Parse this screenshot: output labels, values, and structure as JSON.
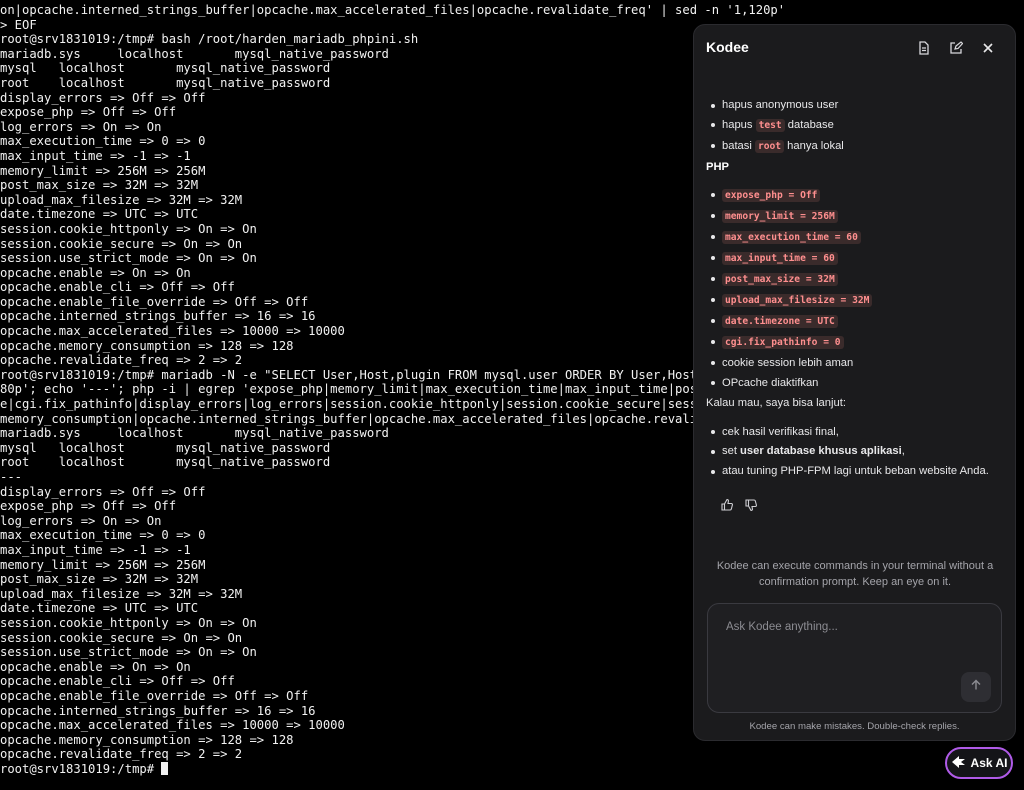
{
  "terminal": {
    "lines": [
      "on|opcache.interned_strings_buffer|opcache.max_accelerated_files|opcache.revalidate_freq' | sed -n '1,120p'",
      "> EOF",
      "root@srv1831019:/tmp# bash /root/harden_mariadb_phpini.sh",
      "mariadb.sys     localhost       mysql_native_password",
      "mysql   localhost       mysql_native_password",
      "root    localhost       mysql_native_password",
      "display_errors => Off => Off",
      "expose_php => Off => Off",
      "log_errors => On => On",
      "max_execution_time => 0 => 0",
      "max_input_time => -1 => -1",
      "memory_limit => 256M => 256M",
      "post_max_size => 32M => 32M",
      "upload_max_filesize => 32M => 32M",
      "date.timezone => UTC => UTC",
      "session.cookie_httponly => On => On",
      "session.cookie_secure => On => On",
      "session.use_strict_mode => On => On",
      "opcache.enable => On => On",
      "opcache.enable_cli => Off => Off",
      "opcache.enable_file_override => Off => Off",
      "opcache.interned_strings_buffer => 16 => 16",
      "opcache.max_accelerated_files => 10000 => 10000",
      "opcache.memory_consumption => 128 => 128",
      "opcache.revalidate_freq => 2 => 2",
      "root@srv1831019:/tmp# mariadb -N -e \"SELECT User,Host,plugin FROM mysql.user ORDER BY User,Host",
      "80p'; echo '---'; php -i | egrep 'expose_php|memory_limit|max_execution_time|max_input_time|pos",
      "e|cgi.fix_pathinfo|display_errors|log_errors|session.cookie_httponly|session.cookie_secure|sess",
      "memory_consumption|opcache.interned_strings_buffer|opcache.max_accelerated_files|opcache.revali",
      "mariadb.sys     localhost       mysql_native_password",
      "mysql   localhost       mysql_native_password",
      "root    localhost       mysql_native_password",
      "---",
      "display_errors => Off => Off",
      "expose_php => Off => Off",
      "log_errors => On => On",
      "max_execution_time => 0 => 0",
      "max_input_time => -1 => -1",
      "memory_limit => 256M => 256M",
      "post_max_size => 32M => 32M",
      "upload_max_filesize => 32M => 32M",
      "date.timezone => UTC => UTC",
      "session.cookie_httponly => On => On",
      "session.cookie_secure => On => On",
      "session.use_strict_mode => On => On",
      "opcache.enable => On => On",
      "opcache.enable_cli => Off => Off",
      "opcache.enable_file_override => Off => Off",
      "opcache.interned_strings_buffer => 16 => 16",
      "opcache.max_accelerated_files => 10000 => 10000",
      "opcache.memory_consumption => 128 => 128",
      "opcache.revalidate_freq => 2 => 2"
    ],
    "prompt": "root@srv1831019:/tmp# "
  },
  "panel": {
    "title": "Kodee",
    "icons": {
      "doc": "document-icon",
      "edit": "edit-icon",
      "close": "close-icon"
    },
    "db_items": [
      {
        "pre": "hapus anonymous user",
        "code": "",
        "post": ""
      },
      {
        "pre": "hapus ",
        "code": "test",
        "post": " database"
      },
      {
        "pre": "batasi ",
        "code": "root",
        "post": " hanya lokal"
      }
    ],
    "php_heading": "PHP",
    "php_items": [
      "expose_php = Off",
      "memory_limit = 256M",
      "max_execution_time = 60",
      "max_input_time = 60",
      "post_max_size = 32M",
      "upload_max_filesize = 32M",
      "date.timezone = UTC",
      "cgi.fix_pathinfo = 0"
    ],
    "php_text_items": [
      "cookie session lebih aman",
      "OPcache diaktifkan"
    ],
    "followup_intro": "Kalau mau, saya bisa lanjut:",
    "followup_items": [
      {
        "pre": "cek hasil verifikasi final,",
        "bold": "",
        "post": ""
      },
      {
        "pre": "set ",
        "bold": "user database khusus aplikasi",
        "post": ","
      },
      {
        "pre": "atau tuning PHP-FPM lagi untuk beban website Anda.",
        "bold": "",
        "post": ""
      }
    ],
    "notice": "Kodee can execute commands in your terminal without a confirmation prompt. Keep an eye on it.",
    "input_placeholder": "Ask Kodee anything...",
    "footer_note": "Kodee can make mistakes. Double-check replies."
  },
  "ask_ai": {
    "label": "Ask AI",
    "icon": "sparkle-icon"
  },
  "colors": {
    "accent_border": "#b05be8",
    "code_text": "#ff8f8f",
    "code_bg": "#3a2b2b"
  }
}
